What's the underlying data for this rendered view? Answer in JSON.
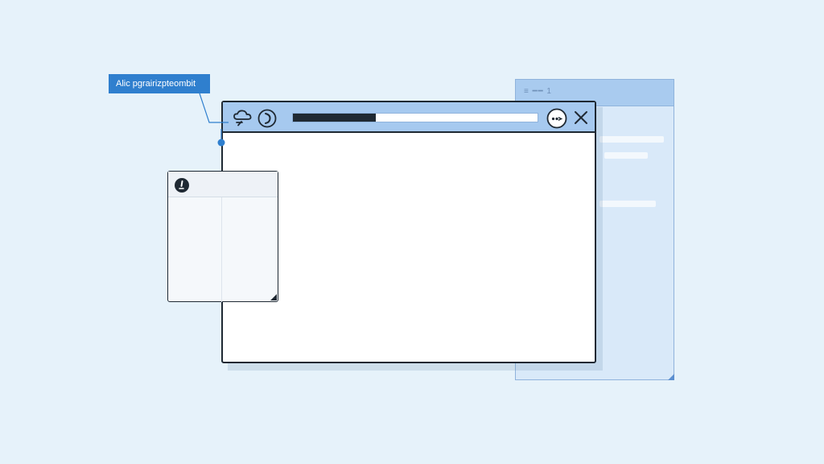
{
  "tooltip": {
    "text": "Alic pgrairizpteombit"
  },
  "background_window": {
    "title": "≡ ━━ 1"
  },
  "main_window": {
    "progress": 0.34,
    "icons": {
      "left_1": "cloud-icon",
      "left_2": "refresh-icon",
      "right_1": "more-icon",
      "right_2": "close-icon"
    }
  },
  "panel": {
    "header_icon": "alert-icon"
  },
  "colors": {
    "background": "#e6f2fa",
    "titlebar": "#a6c9ef",
    "accent": "#2f7fce",
    "border": "#1f2933"
  }
}
